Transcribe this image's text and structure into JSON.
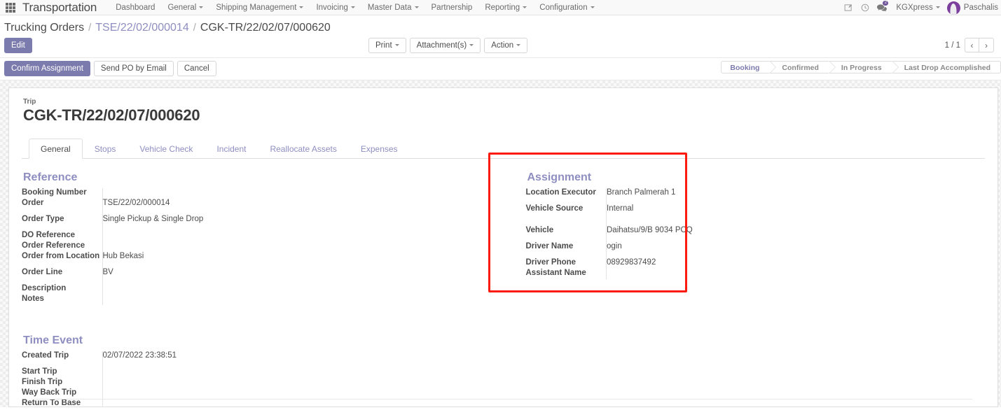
{
  "navbar": {
    "apps_icon": "apps-grid-icon",
    "brand": "Transportation",
    "menu": [
      {
        "label": "Dashboard",
        "has_caret": false
      },
      {
        "label": "General",
        "has_caret": true
      },
      {
        "label": "Shipping Management",
        "has_caret": true
      },
      {
        "label": "Invoicing",
        "has_caret": true
      },
      {
        "label": "Master Data",
        "has_caret": true
      },
      {
        "label": "Partnership",
        "has_caret": false
      },
      {
        "label": "Reporting",
        "has_caret": true
      },
      {
        "label": "Configuration",
        "has_caret": true
      }
    ],
    "right": {
      "edit_icon": "edit-note-icon",
      "activity_icon": "clock-icon",
      "messages_icon": "chat-icon",
      "messages_count": "2",
      "company": "KGXpress",
      "avatar": "user-avatar",
      "user": "Paschalis"
    }
  },
  "breadcrumb": {
    "root": "Trucking Orders",
    "sep": "/",
    "parent": "TSE/22/02/000014",
    "current": "CGK-TR/22/02/07/000620"
  },
  "controls": {
    "edit_label": "Edit",
    "print_label": "Print",
    "attachments_label": "Attachment(s)",
    "action_label": "Action",
    "pager_text": "1 / 1",
    "prev_icon": "chevron-left-icon",
    "next_icon": "chevron-right-icon"
  },
  "actions": {
    "confirm_assignment": "Confirm Assignment",
    "send_po": "Send PO by Email",
    "cancel": "Cancel"
  },
  "statusbar": {
    "items": [
      "Booking",
      "Confirmed",
      "In Progress",
      "Last Drop Accomplished"
    ],
    "active": "Booking",
    "active_color": "#7c7bad"
  },
  "record": {
    "trip_label": "Trip",
    "trip_value": "CGK-TR/22/02/07/000620"
  },
  "tabs": [
    {
      "label": "General",
      "active": true
    },
    {
      "label": "Stops",
      "active": false
    },
    {
      "label": "Vehicle Check",
      "active": false
    },
    {
      "label": "Incident",
      "active": false
    },
    {
      "label": "Reallocate Assets",
      "active": false
    },
    {
      "label": "Expenses",
      "active": false
    }
  ],
  "reference": {
    "title": "Reference",
    "fields": [
      {
        "label": "Booking Number",
        "value": ""
      },
      {
        "label": "Order",
        "value": "TSE/22/02/000014",
        "is_link": true
      },
      {
        "label": "Order Type",
        "value": "Single Pickup & Single Drop"
      },
      {
        "label": "DO Reference",
        "value": ""
      },
      {
        "label": "Order Reference",
        "value": ""
      },
      {
        "label": "Order from Location",
        "value": "Hub Bekasi",
        "is_link": true
      },
      {
        "label": "Order Line",
        "value": "BV",
        "is_link": true
      },
      {
        "label": "Description",
        "value": ""
      },
      {
        "label": "Notes",
        "value": ""
      }
    ]
  },
  "assignment": {
    "title": "Assignment",
    "highlight_color": "#fc1b0f",
    "fields": [
      {
        "label": "Location Executor",
        "value": "Branch Palmerah 1"
      },
      {
        "label": "Vehicle Source",
        "value": "Internal"
      },
      {
        "label": "Vehicle",
        "value": "Daihatsu/9/B 9034 PCQ"
      },
      {
        "label": "Driver Name",
        "value": "ogin"
      },
      {
        "label": "Driver Phone",
        "value": "08929837492"
      },
      {
        "label": "Assistant Name",
        "value": ""
      }
    ]
  },
  "time_event": {
    "title": "Time Event",
    "fields": [
      {
        "label": "Created Trip",
        "value": "02/07/2022 23:38:51"
      },
      {
        "label": "Start Trip",
        "value": ""
      },
      {
        "label": "Finish Trip",
        "value": ""
      },
      {
        "label": "Way Back Trip",
        "value": ""
      },
      {
        "label": "Return To Base",
        "value": ""
      }
    ]
  }
}
